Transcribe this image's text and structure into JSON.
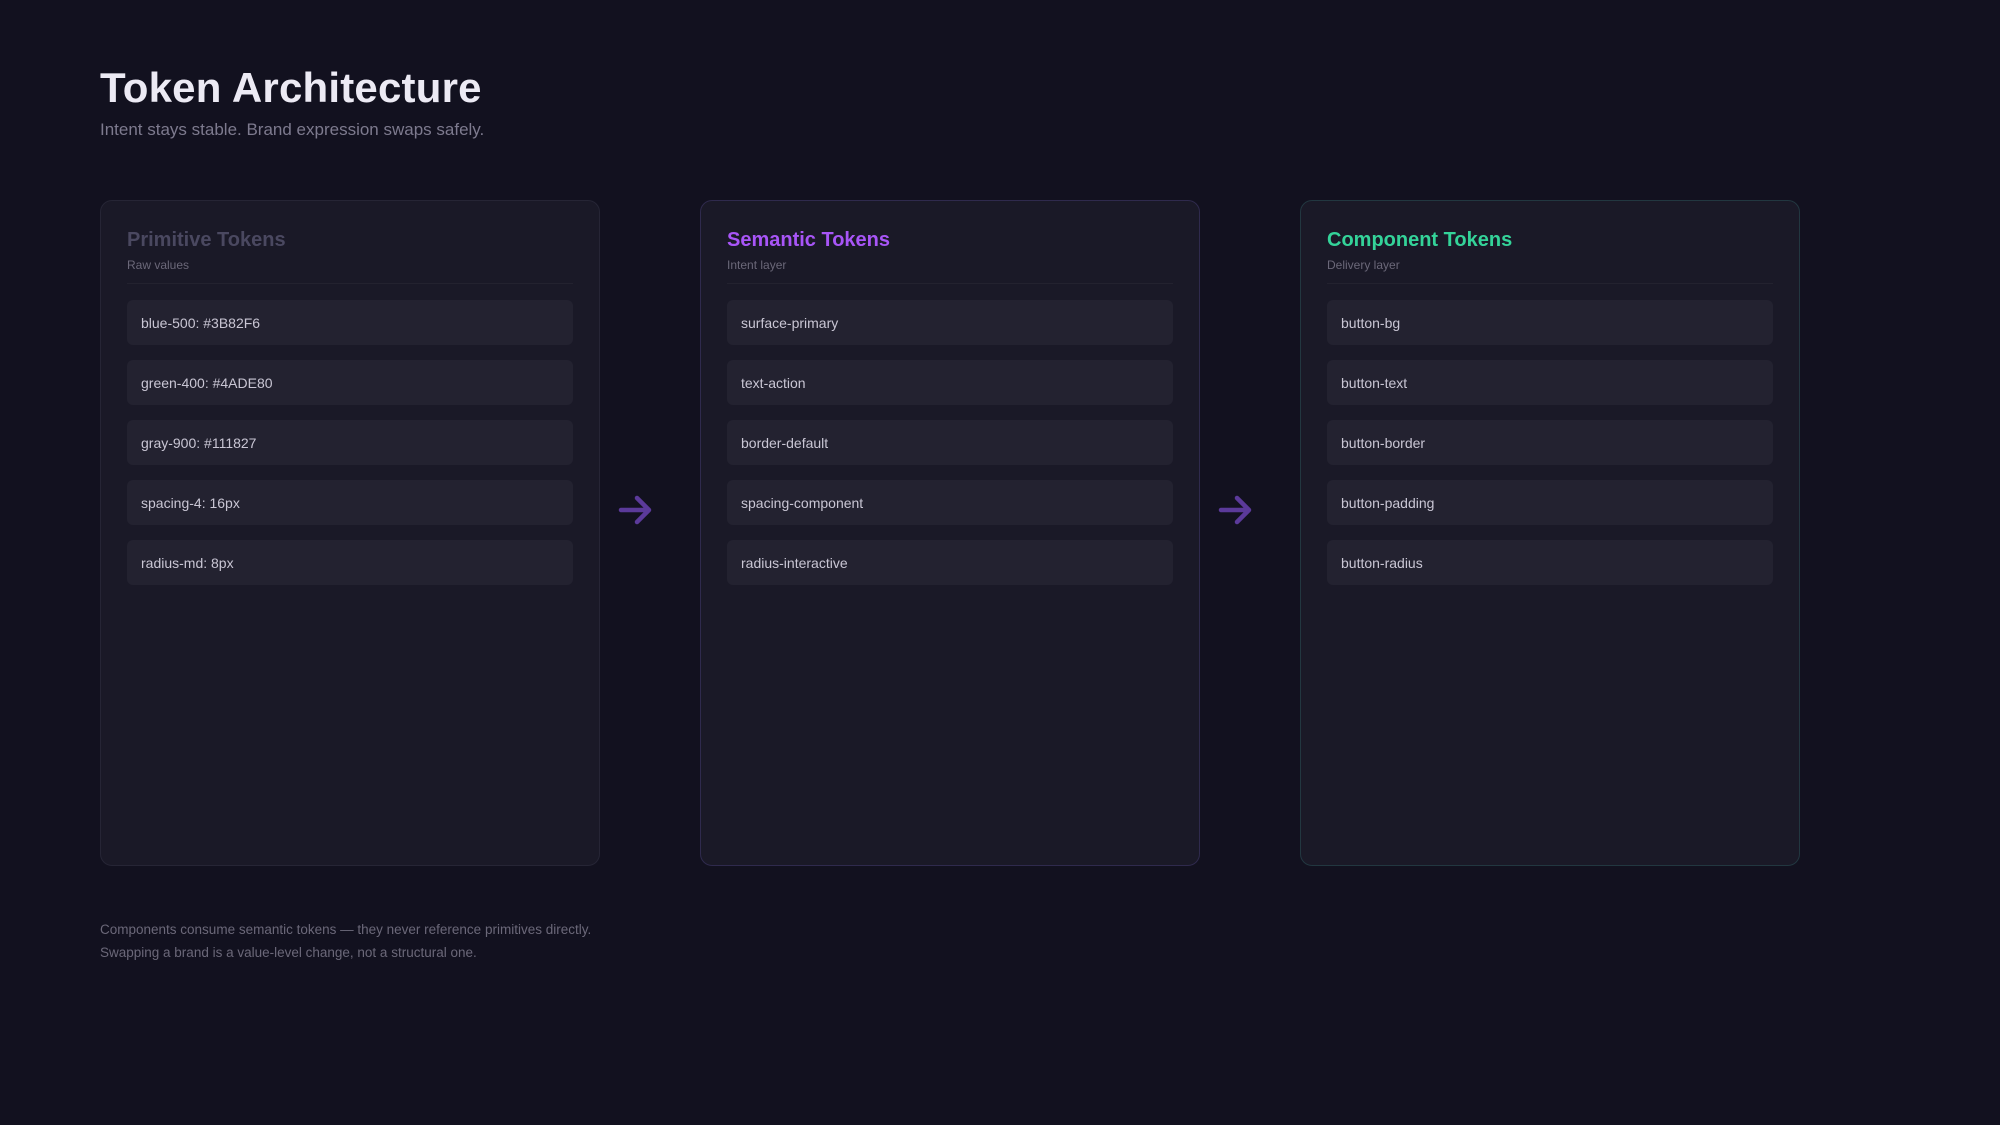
{
  "header": {
    "title": "Token Architecture",
    "subtitle": "Intent stays stable. Brand expression swaps safely."
  },
  "columns": [
    {
      "title": "Primitive Tokens",
      "subtitle": "Raw values",
      "title_color": "#4a4860",
      "tokens": [
        "blue-500: #3B82F6",
        "green-400: #4ADE80",
        "gray-900: #111827",
        "spacing-4: 16px",
        "radius-md: 8px"
      ]
    },
    {
      "title": "Semantic Tokens",
      "subtitle": "Intent layer",
      "title_color": "#a855f7",
      "tokens": [
        "surface-primary",
        "text-action",
        "border-default",
        "spacing-component",
        "radius-interactive"
      ]
    },
    {
      "title": "Component Tokens",
      "subtitle": "Delivery layer",
      "title_color": "#34d399",
      "tokens": [
        "button-bg",
        "button-text",
        "button-border",
        "button-padding",
        "button-radius"
      ]
    }
  ],
  "arrows": {
    "icon": "arrow-right-icon",
    "color": "#5b3a9a"
  },
  "footnote": {
    "line1": "Components consume semantic tokens — they never reference primitives directly.",
    "line2": "Swapping a brand is a value-level change, not a structural one."
  }
}
